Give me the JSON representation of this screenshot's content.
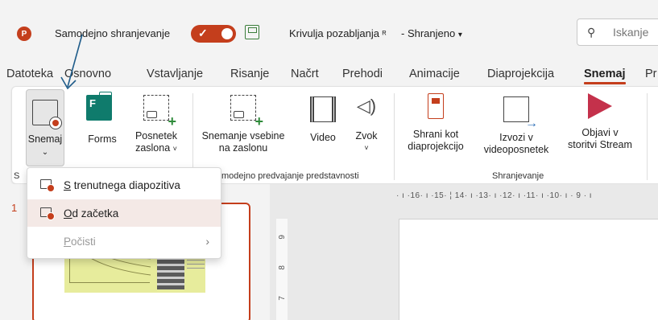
{
  "titlebar": {
    "app_icon": "P",
    "autosave_label": "Samodejno shranjevanje",
    "doc_title": "Krivulja pozabljanja",
    "doc_status": "- Shranjeno",
    "status_chevron": "▾",
    "search_placeholder": "Iskanje"
  },
  "tabs": [
    {
      "label": "Datoteka"
    },
    {
      "label": "Osnovno"
    },
    {
      "label": "Vstavljanje"
    },
    {
      "label": "Risanje"
    },
    {
      "label": "Načrt"
    },
    {
      "label": "Prehodi"
    },
    {
      "label": "Animacije"
    },
    {
      "label": "Diaprojekcija"
    },
    {
      "label": "Snemaj",
      "active": true
    },
    {
      "label": "Pr"
    }
  ],
  "ribbon": {
    "snemaj": "Snemaj",
    "snemaj_chevron": "⌄",
    "forms": "Forms",
    "posnetek": "Posnetek",
    "zaslona": "zaslona",
    "snemanje_vsebine": "Snemanje vsebine",
    "na_zaslonu": "na zaslonu",
    "video": "Video",
    "zvok": "Zvok",
    "shrani_kot": "Shrani kot",
    "diaprojekcijo": "diaprojekcijo",
    "izvozi_v": "Izvozi v",
    "videoposnetek": "videoposnetek",
    "objavi_v": "Objavi v",
    "storitvi_stream": "storitvi Stream",
    "group_autoplay": "modejno predvajanje predstavnosti",
    "group_save": "Shranjevanje",
    "group_first_letter": "S"
  },
  "menu": {
    "items": [
      {
        "label": "S trenutnega diapozitiva",
        "key": "S",
        "rest": " trenutnega diapozitiva"
      },
      {
        "label": "Od začetka",
        "key": "O",
        "rest": "d začetka"
      },
      {
        "label": "Počisti",
        "key": "P",
        "rest": "očisti",
        "submenu": "›"
      }
    ]
  },
  "slides": {
    "number": "1"
  },
  "ruler": {
    "top": "· ı ·16· ı ·15· ¦ 14· ı ·13· ı ·12· ı ·11· ı ·10· ı · 9 · ı",
    "left": [
      "9",
      "8",
      "7"
    ]
  },
  "colors": {
    "accent": "#c43e1c",
    "annotation": "#1f5c8a"
  }
}
